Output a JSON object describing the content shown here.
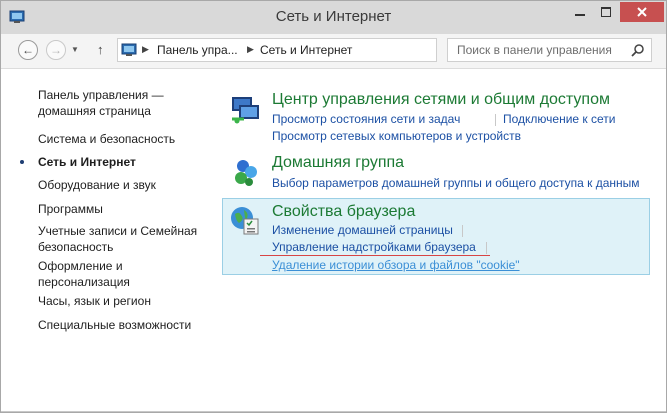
{
  "window": {
    "title": "Сеть и Интернет"
  },
  "address": {
    "crumbs": [
      "Панель упра...",
      "Сеть и Интернет"
    ]
  },
  "search": {
    "placeholder": "Поиск в панели управления"
  },
  "sidebar": {
    "items": [
      {
        "label": "Панель управления —",
        "label2": "домашняя страница"
      },
      {
        "label": "Система и безопасность"
      },
      {
        "label": "Сеть и Интернет"
      },
      {
        "label": "Оборудование и звук"
      },
      {
        "label": "Программы"
      },
      {
        "label": "Учетные записи и Семейная",
        "label2": "безопасность"
      },
      {
        "label": "Оформление и",
        "label2": "персонализация"
      },
      {
        "label": "Часы, язык и регион"
      },
      {
        "label": "Специальные возможности"
      }
    ]
  },
  "categories": [
    {
      "title": "Центр управления сетями и общим доступом",
      "links": [
        "Просмотр состояния сети и задач",
        "Подключение к сети",
        "Просмотр сетевых компьютеров и устройств"
      ]
    },
    {
      "title": "Домашняя группа",
      "links": [
        "Выбор параметров домашней группы и общего доступа к данным"
      ]
    },
    {
      "title": "Свойства браузера",
      "links": [
        "Изменение домашней страницы",
        "Управление надстройками браузера",
        "Удаление истории обзора и файлов \"cookie\""
      ]
    }
  ],
  "colors": {
    "category_title": "#1c7a34",
    "link": "#1c50a4",
    "highlight_bg": "#dff2f8",
    "close_button": "#c75050"
  }
}
